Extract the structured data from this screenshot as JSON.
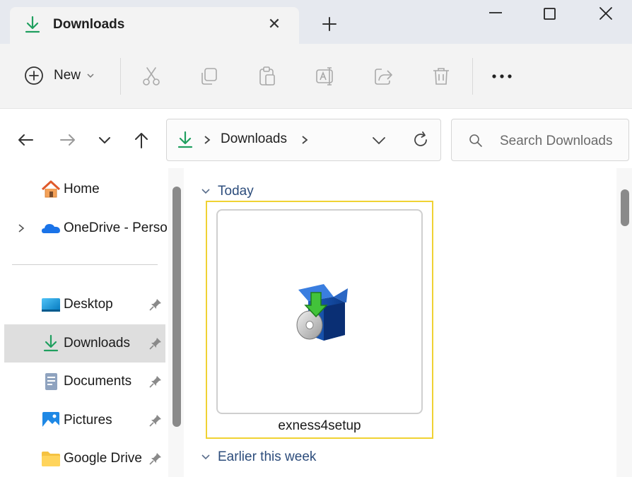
{
  "window": {
    "tab_title": "Downloads",
    "tab_icon": "download-arrow-icon",
    "close_tab_glyph": "✕",
    "new_tab_icon": "plus-icon",
    "controls": [
      "minimize-icon",
      "maximize-icon",
      "close-icon"
    ]
  },
  "commandbar": {
    "new_label": "New",
    "actions": [
      "cut-icon",
      "copy-icon",
      "paste-icon",
      "rename-icon",
      "share-icon",
      "delete-icon"
    ],
    "more_icon": "ellipsis-icon"
  },
  "navigation": {
    "buttons": [
      "back-arrow-icon",
      "forward-arrow-icon",
      "recent-chevron-icon",
      "up-arrow-icon"
    ],
    "breadcrumb": [
      "Downloads"
    ],
    "search_placeholder": "Search Downloads"
  },
  "sidebar": {
    "items": [
      {
        "label": "Home",
        "icon": "home-icon"
      },
      {
        "label": "OneDrive - Perso",
        "icon": "onedrive-cloud-icon",
        "expandable": true
      },
      {
        "label": "Desktop",
        "icon": "desktop-icon",
        "pinned": true
      },
      {
        "label": "Downloads",
        "icon": "download-arrow-icon",
        "pinned": true,
        "selected": true
      },
      {
        "label": "Documents",
        "icon": "documents-icon",
        "pinned": true
      },
      {
        "label": "Pictures",
        "icon": "pictures-icon",
        "pinned": true
      },
      {
        "label": "Google Drive",
        "icon": "folder-icon",
        "pinned": true
      }
    ]
  },
  "content": {
    "groups": [
      {
        "label": "Today",
        "files": [
          {
            "name": "exness4setup",
            "icon": "installer-box-icon",
            "selected": true
          }
        ]
      },
      {
        "label": "Earlier this week",
        "files": []
      }
    ]
  },
  "colors": {
    "accent_green": "#1f9f5f",
    "group_header": "#2d4d7c",
    "selection_border": "#f0d233",
    "selected_nav": "#dedede"
  }
}
